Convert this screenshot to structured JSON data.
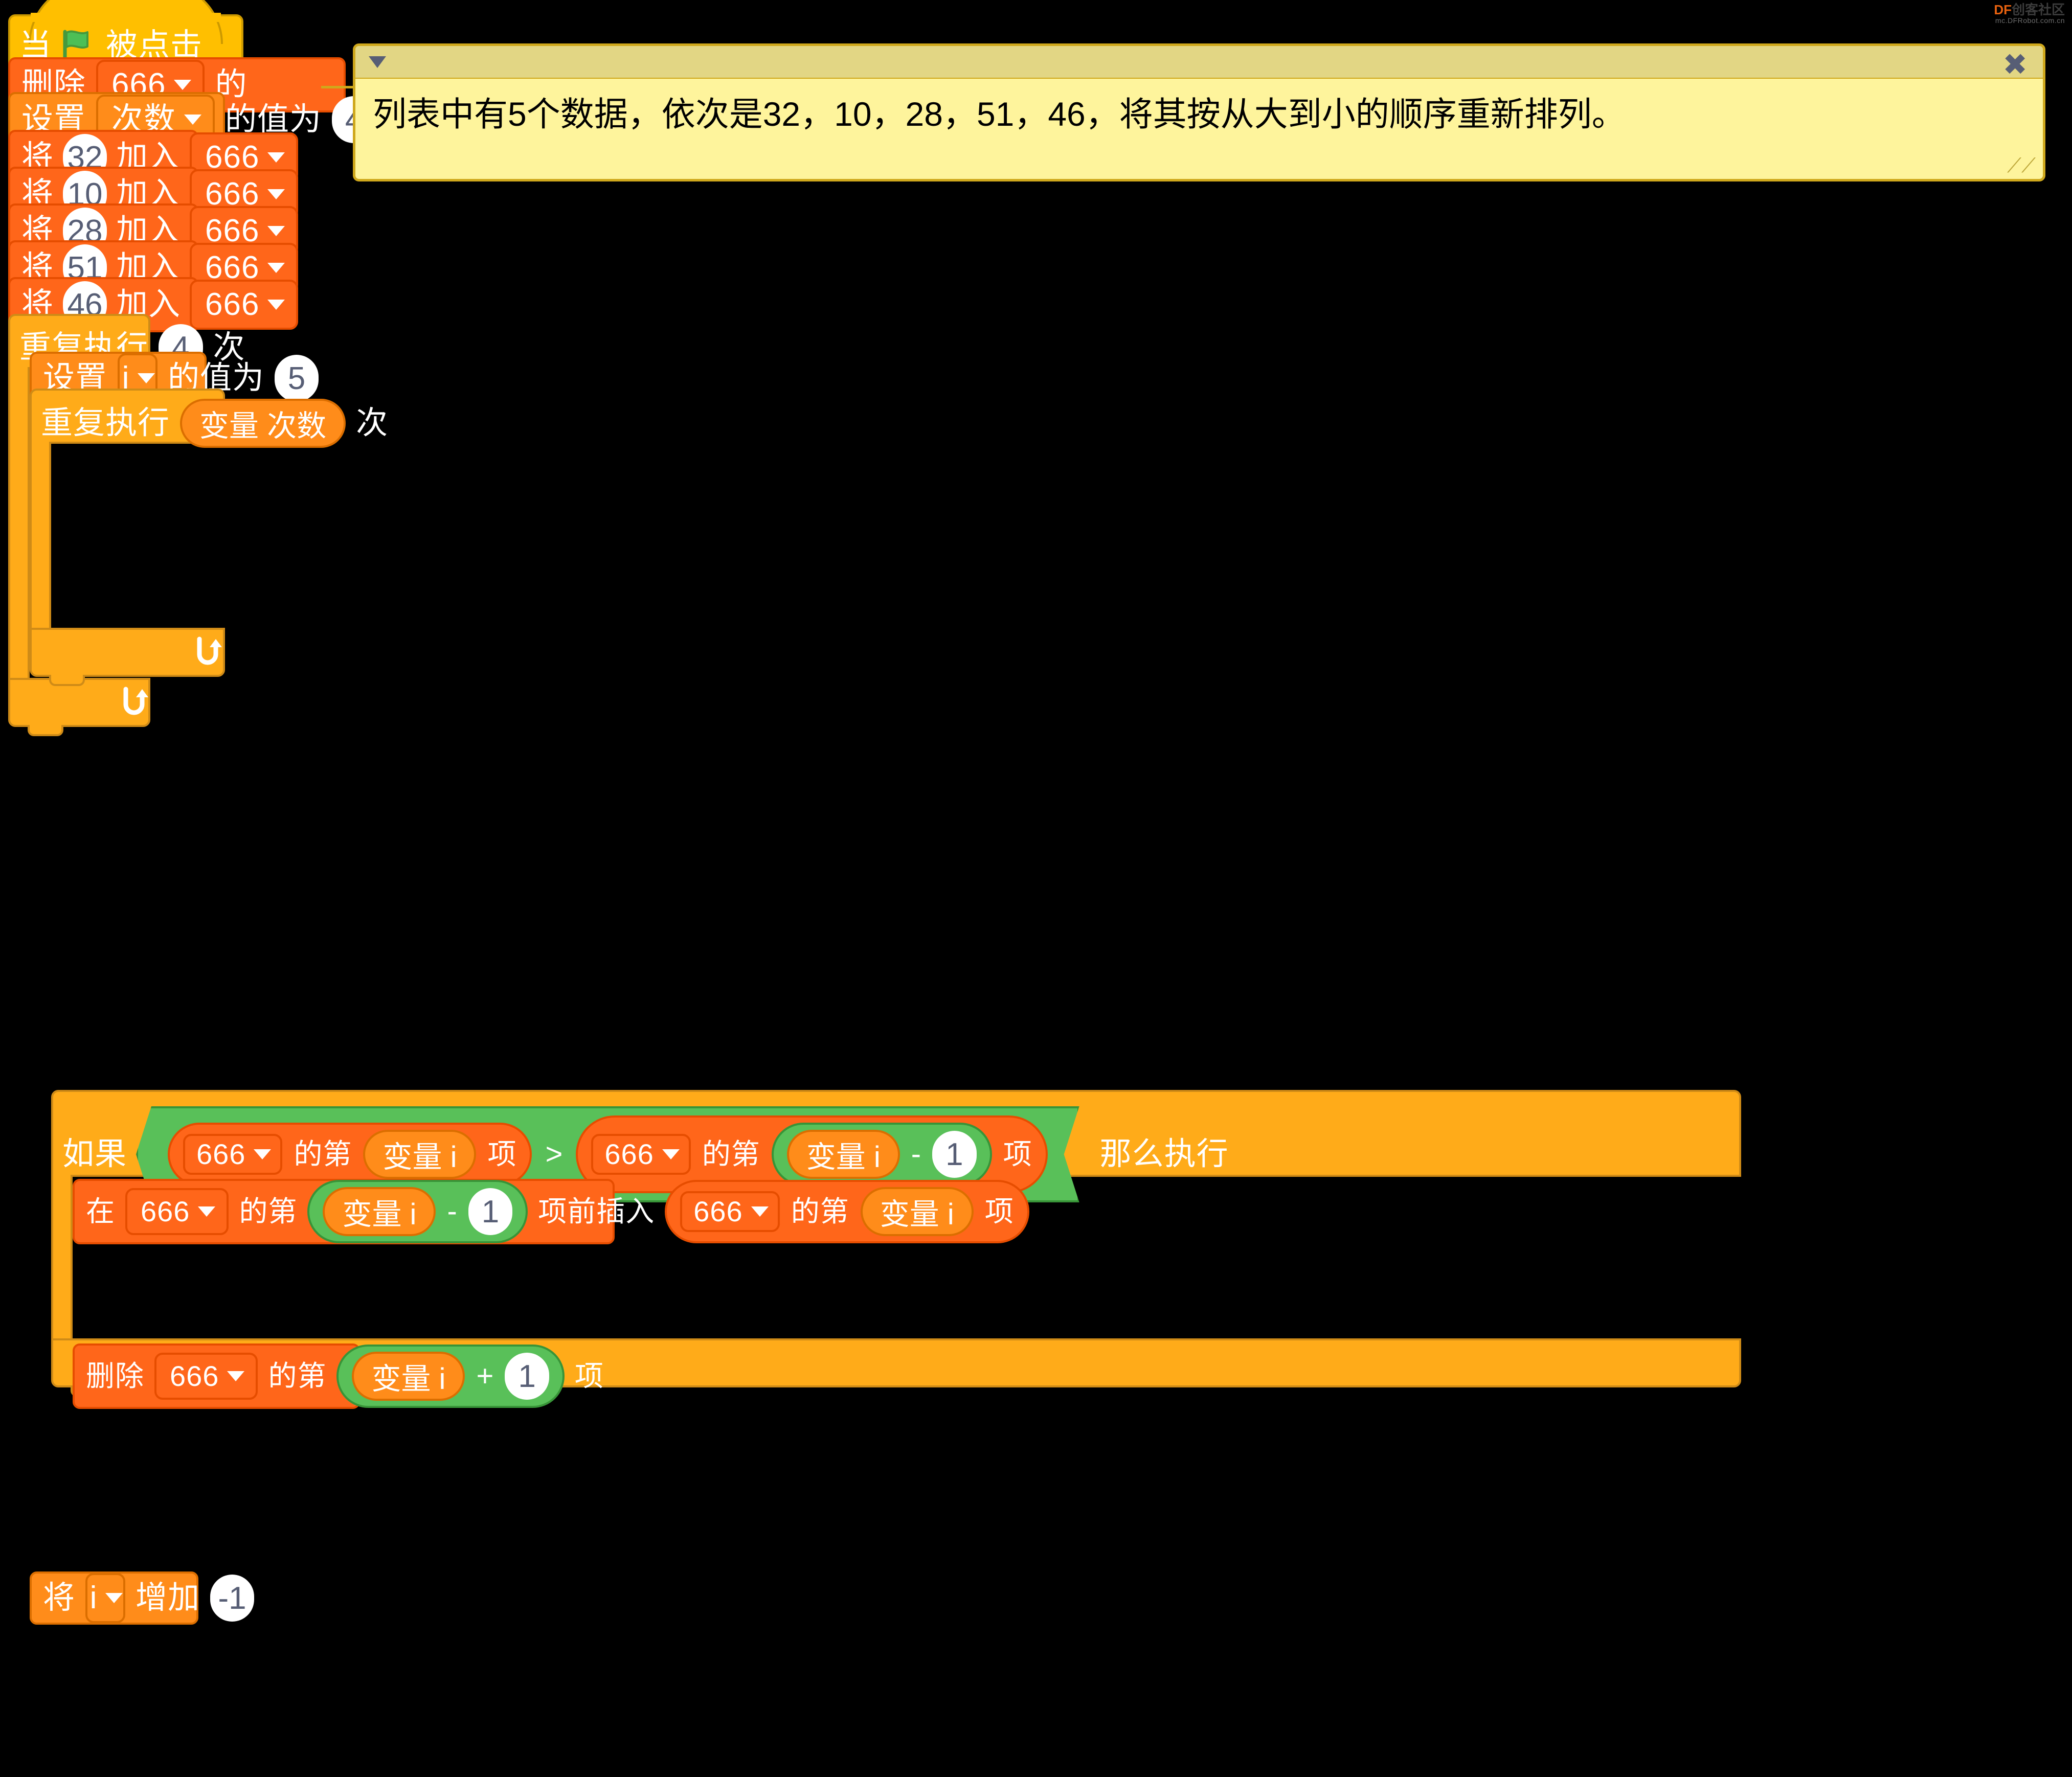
{
  "watermark": {
    "line1_brand": "DF",
    "line1_rest": "创客社区",
    "line2": "mc.DFRobot.com.cn"
  },
  "comment": {
    "text": "列表中有5个数据，依次是32，10，28，51，46，将其按从大到小的顺序重新排列。",
    "collapse_icon": "chevron-down-icon",
    "close_icon": "close-icon",
    "resize_icon": "resize-grip-icon"
  },
  "script": {
    "hat": {
      "when": "当",
      "flag": "green-flag-icon",
      "clicked": "被点击"
    },
    "delete_all": {
      "verb": "删除",
      "list": "666",
      "suffix": "的"
    },
    "set_count": {
      "verb": "设置",
      "variable": "次数",
      "mid": "的值为",
      "value": "4"
    },
    "add_items": [
      {
        "verb": "将",
        "value": "32",
        "mid": "加入",
        "list": "666"
      },
      {
        "verb": "将",
        "value": "10",
        "mid": "加入",
        "list": "666"
      },
      {
        "verb": "将",
        "value": "28",
        "mid": "加入",
        "list": "666"
      },
      {
        "verb": "将",
        "value": "51",
        "mid": "加入",
        "list": "666"
      },
      {
        "verb": "将",
        "value": "46",
        "mid": "加入",
        "list": "666"
      }
    ],
    "outer_repeat": {
      "verb": "重复执行",
      "times": "4",
      "unit": "次"
    },
    "set_i": {
      "verb": "设置",
      "variable": "i",
      "mid": "的值为",
      "value": "5"
    },
    "inner_repeat": {
      "verb": "重复执行",
      "times": "变量 次数",
      "unit": "次"
    },
    "if_block": {
      "if": "如果",
      "then": "那么执行",
      "operator": ">",
      "left": {
        "list": "666",
        "mid": "的第",
        "index": "变量 i",
        "suffix": "项"
      },
      "right": {
        "list": "666",
        "mid": "的第",
        "index": "变量 i",
        "op": "-",
        "operand": "1",
        "suffix": "项"
      }
    },
    "insert": {
      "at": "在",
      "list": "666",
      "mid": "的第",
      "index": "变量 i",
      "op": "-",
      "operand": "1",
      "before": "项前插入",
      "src_list": "666",
      "src_mid": "的第",
      "src_index": "变量 i",
      "src_suffix": "项"
    },
    "delete_item": {
      "verb": "删除",
      "list": "666",
      "mid": "的第",
      "index": "变量 i",
      "op": "+",
      "operand": "1",
      "suffix": "项"
    },
    "change_i": {
      "verb": "将",
      "variable": "i",
      "mid": "增加",
      "value": "-1"
    },
    "loop_arrow_icon": "loop-arrow-icon"
  }
}
